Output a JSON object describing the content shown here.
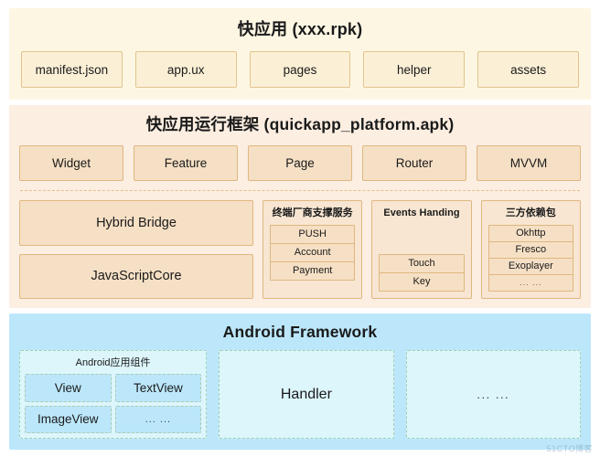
{
  "layers": {
    "app": {
      "title": "快应用 (xxx.rpk)",
      "items": [
        {
          "label": "manifest.json"
        },
        {
          "label": "app.ux"
        },
        {
          "label": "pages"
        },
        {
          "label": "helper"
        },
        {
          "label": "assets"
        }
      ]
    },
    "framework": {
      "title": "快应用运行框架 (quickapp_platform.apk)",
      "top_row": [
        {
          "label": "Widget"
        },
        {
          "label": "Feature"
        },
        {
          "label": "Page"
        },
        {
          "label": "Router"
        },
        {
          "label": "MVVM"
        }
      ],
      "left_column": [
        {
          "label": "Hybrid Bridge"
        },
        {
          "label": "JavaScriptCore"
        }
      ],
      "groups": [
        {
          "title": "终端厂商支撑服务",
          "items": [
            "PUSH",
            "Account",
            "Payment"
          ]
        },
        {
          "title": "Events Handing",
          "items": [
            "Touch",
            "Key"
          ]
        },
        {
          "title": "三方依赖包",
          "items": [
            "Okhttp",
            "Fresco",
            "Exoplayer",
            "... ..."
          ]
        }
      ]
    },
    "android": {
      "title": "Android Framework",
      "components_group": {
        "title": "Android应用组件",
        "cells": [
          "View",
          "TextView",
          "ImageView",
          "... ..."
        ]
      },
      "handler_label": "Handler",
      "other_label": "... ..."
    }
  },
  "watermark": "51CTO博客",
  "colors": {
    "app_panel": "#fdf6e3",
    "app_box": "#fbf0d6",
    "app_border": "#e2c48e",
    "framework_panel": "#fceee1",
    "framework_box": "#f6e0c5",
    "framework_border": "#dfb780",
    "android_panel": "#bce7fb",
    "android_group": "#ddf6fc",
    "android_border": "#9fcfae"
  }
}
